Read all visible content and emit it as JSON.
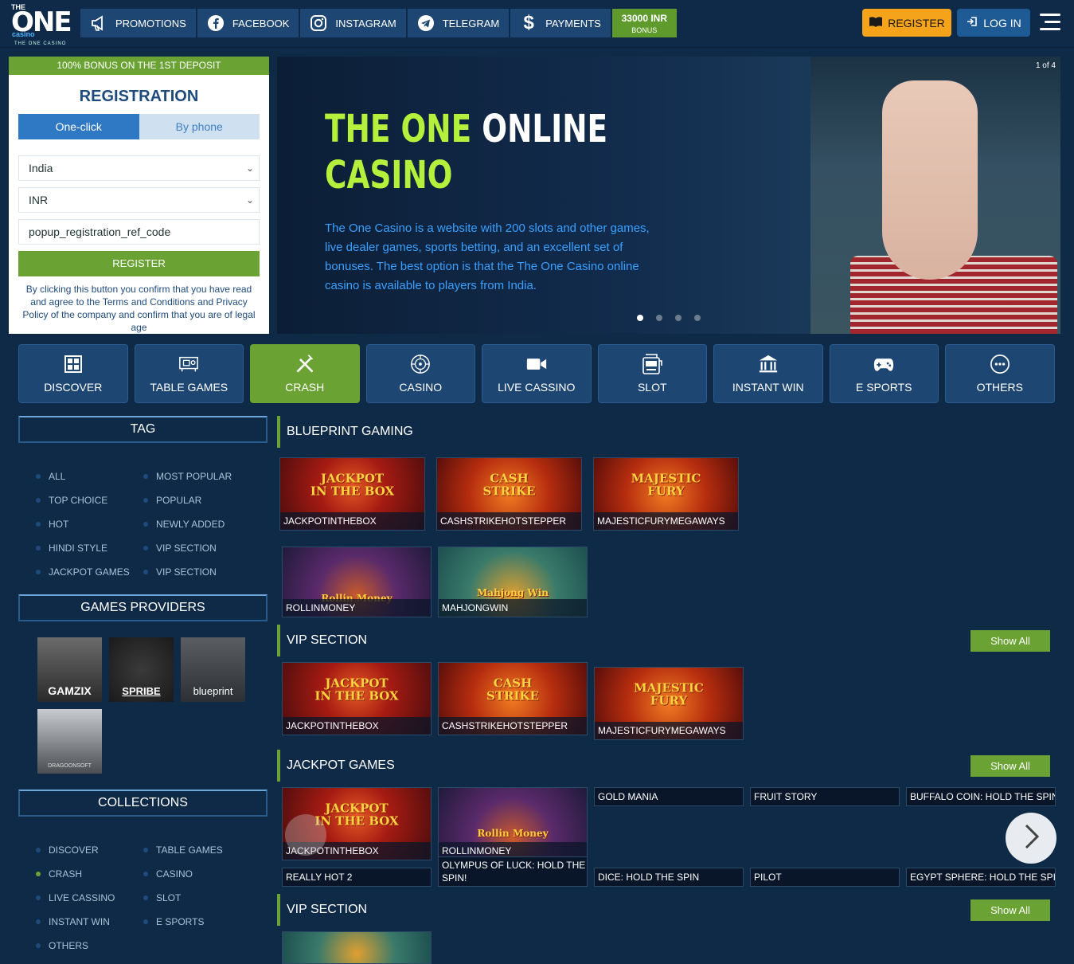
{
  "header": {
    "logo": {
      "the": "THE",
      "one": "ONE",
      "casino": "casino",
      "tagline": "THE ONE CASINO"
    },
    "nav": [
      {
        "label": "PROMOTIONS",
        "icon": "megaphone-icon"
      },
      {
        "label": "FACEBOOK",
        "icon": "facebook-icon"
      },
      {
        "label": "INSTAGRAM",
        "icon": "instagram-icon"
      },
      {
        "label": "TELEGRAM",
        "icon": "telegram-icon"
      },
      {
        "label": "PAYMENTS",
        "icon": "dollar-icon"
      }
    ],
    "bonus": {
      "amount": "33000 INR",
      "label": "BONUS"
    },
    "register_label": "REGISTER",
    "login_label": "LOG IN"
  },
  "registration": {
    "bonus_bar": "100% BONUS ON THE 1ST DEPOSIT",
    "title": "REGISTRATION",
    "tabs": [
      "One-click",
      "By phone"
    ],
    "country": "India",
    "currency": "INR",
    "ref_code_placeholder": "popup_registration_ref_code",
    "submit_label": "REGISTER",
    "note": "By clicking this button you confirm that you have read and agree to the Terms and Conditions and Privacy Policy of the company and confirm that you are of legal age"
  },
  "banner": {
    "counter": "1 of 4",
    "title_green": "THE ONE",
    "title_white": "ONLINE",
    "title_line2": "CASINO",
    "description": "The One Casino  is a website with 200 slots and other games, live dealer games, sports betting, and an excellent set of bonuses. The best option is that the The One Casino online casino is available to players from India.",
    "slides": 4,
    "active_slide": 1
  },
  "categories": [
    {
      "label": "DISCOVER",
      "icon": "grid-icon"
    },
    {
      "label": "TABLE GAMES",
      "icon": "table-icon"
    },
    {
      "label": "CRASH",
      "icon": "crash-icon",
      "active": true
    },
    {
      "label": "CASINO",
      "icon": "roulette-icon"
    },
    {
      "label": "LIVE CASSINO",
      "icon": "video-camera-icon"
    },
    {
      "label": "SLOT",
      "icon": "slot-machine-icon"
    },
    {
      "label": "INSTANT WIN",
      "icon": "bank-icon"
    },
    {
      "label": "E SPORTS",
      "icon": "gamepad-icon"
    },
    {
      "label": "OTHERS",
      "icon": "more-dots-icon"
    }
  ],
  "sidebar": {
    "tag_title": "TAG",
    "tags": [
      "ALL",
      "MOST POPULAR",
      "TOP CHOICE",
      "POPULAR",
      "HOT",
      "NEWLY ADDED",
      "HINDI STYLE",
      "VIP SECTION",
      "JACKPOT GAMES",
      "VIP SECTION"
    ],
    "providers_title": "GAMES PROVIDERS",
    "providers": [
      "GAMZIX",
      "SPRIBE",
      "blueprint",
      "DRAGOONSOFT"
    ],
    "collections_title": "COLLECTIONS",
    "collections": [
      "DISCOVER",
      "TABLE GAMES",
      "CRASH",
      "CASINO",
      "LIVE CASSINO",
      "SLOT",
      "INSTANT WIN",
      "E SPORTS",
      "OTHERS"
    ],
    "active_collection": "CRASH"
  },
  "sections": [
    {
      "title": "BLUEPRINT GAMING"
    },
    {
      "title": "VIP SECTION",
      "show_all": "Show All"
    },
    {
      "title": "JACKPOT GAMES",
      "show_all": "Show All"
    },
    {
      "title": "VIP SECTION",
      "show_all": "Show All"
    }
  ],
  "games": {
    "blueprint": [
      "JACKPOTINTHEBOX",
      "CASHSTRIKEHOTSTEPPER",
      "MAJESTICFURYMEGAWAYS",
      "ROLLINMONEY",
      "MAHJONGWIN"
    ],
    "vip": [
      "JACKPOTINTHEBOX",
      "CASHSTRIKEHOTSTEPPER",
      "MAJESTICFURYMEGAWAYS"
    ],
    "jackpot_row1": [
      "JACKPOTINTHEBOX",
      "ROLLINMONEY",
      "GOLD MANIA",
      "FRUIT STORY",
      "BUFFALO COIN: HOLD THE SPIN"
    ],
    "jackpot_row2": [
      "REALLY HOT 2",
      "OLYMPUS OF LUCK: HOLD THE SPIN!",
      "DICE: HOLD THE SPIN",
      "PILOT",
      "EGYPT SPHERE: HOLD THE SPIN"
    ]
  },
  "tile_art": {
    "jackpot": "JACKPOT\nIN THE BOX",
    "cash": "CASH\nSTRIKE",
    "majestic": "MAJESTIC\nFURY",
    "rollin": "Rollin Money",
    "mahjong": "Mahjong Win"
  },
  "colors": {
    "accent_green": "#6aa333",
    "nav_blue": "#1d4672",
    "register_orange": "#f5a31a",
    "banner_green": "#b4f03c"
  }
}
